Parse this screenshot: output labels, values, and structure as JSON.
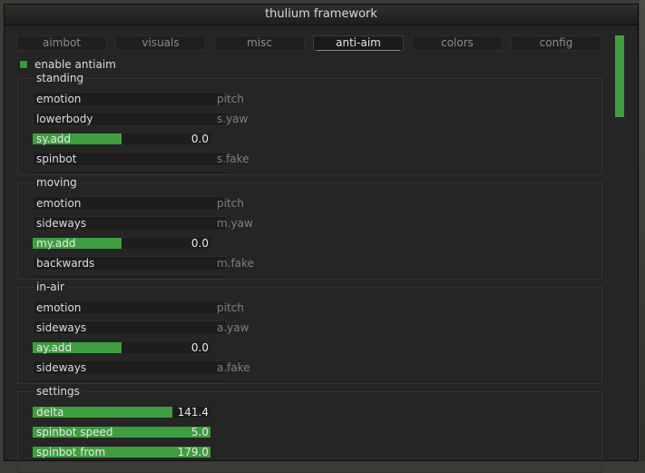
{
  "window": {
    "title": "thulium framework"
  },
  "tabs": [
    {
      "label": "aimbot"
    },
    {
      "label": "visuals"
    },
    {
      "label": "misc"
    },
    {
      "label": "anti-aim",
      "active": true
    },
    {
      "label": "colors"
    },
    {
      "label": "config"
    }
  ],
  "enable_antiaim": {
    "label": "enable antiaim",
    "checked": true
  },
  "groups": {
    "standing": {
      "title": "standing",
      "pitch": {
        "value": "emotion",
        "side": "pitch"
      },
      "yaw": {
        "value": "lowerbody",
        "side": "s.yaw"
      },
      "add": {
        "label": "sy.add",
        "value": "0.0",
        "fill": 0.5
      },
      "fake": {
        "value": "spinbot",
        "side": "s.fake"
      }
    },
    "moving": {
      "title": "moving",
      "pitch": {
        "value": "emotion",
        "side": "pitch"
      },
      "yaw": {
        "value": "sideways",
        "side": "m.yaw"
      },
      "add": {
        "label": "my.add",
        "value": "0.0",
        "fill": 0.5
      },
      "fake": {
        "value": "backwards",
        "side": "m.fake"
      }
    },
    "in_air": {
      "title": "in-air",
      "pitch": {
        "value": "emotion",
        "side": "pitch"
      },
      "yaw": {
        "value": "sideways",
        "side": "a.yaw"
      },
      "add": {
        "label": "ay.add",
        "value": "0.0",
        "fill": 0.5
      },
      "fake": {
        "value": "sideways",
        "side": "a.fake"
      }
    },
    "settings": {
      "title": "settings",
      "delta": {
        "label": "delta",
        "value": "141.4",
        "fill": 0.785
      },
      "spin_speed": {
        "label": "spinbot speed",
        "value": "5.0",
        "fill": 1.0
      },
      "spin_from": {
        "label": "spinbot from",
        "value": "179.0",
        "fill": 1.0
      }
    }
  },
  "colors": {
    "accent": "#3f9e3f",
    "panel": "#252525",
    "field": "#1d1d1d",
    "text": "#dcdcdc",
    "muted": "#7f7f7f"
  }
}
